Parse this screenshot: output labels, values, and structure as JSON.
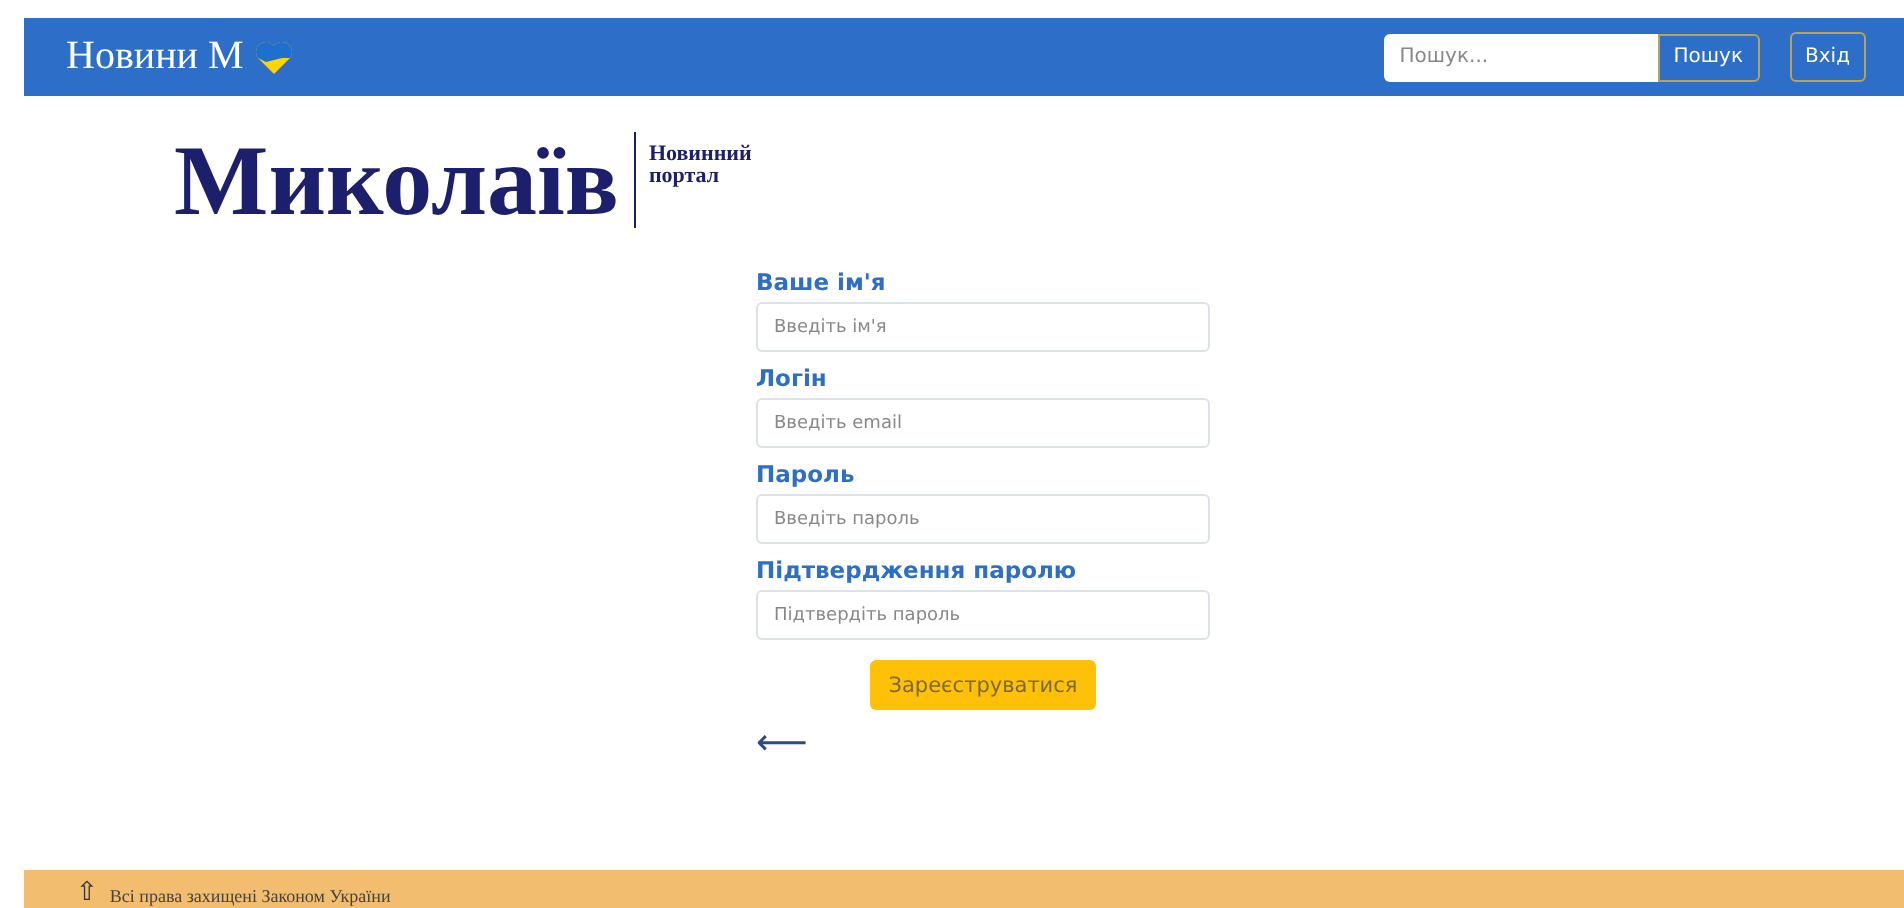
{
  "navbar": {
    "brand": "Новини М",
    "search": {
      "placeholder": "Пошук..."
    },
    "search_button": "Пошук",
    "login_button": "Вхід"
  },
  "logo": {
    "title": "Миколаїв",
    "subtitle_1": "Новинний",
    "subtitle_2": "портал"
  },
  "form": {
    "fields": [
      {
        "label": "Ваше ім'я",
        "placeholder": "Введіть ім'я"
      },
      {
        "label": "Логін",
        "placeholder": "Введіть email"
      },
      {
        "label": "Пароль",
        "placeholder": "Введіть пароль"
      },
      {
        "label": "Підтвердження паролю",
        "placeholder": "Підтвердіть пароль"
      }
    ],
    "submit": "Зареєструватися",
    "back": "⟵"
  },
  "footer": {
    "arrow": "⇧",
    "text": "Всі права захищені Законом України"
  }
}
